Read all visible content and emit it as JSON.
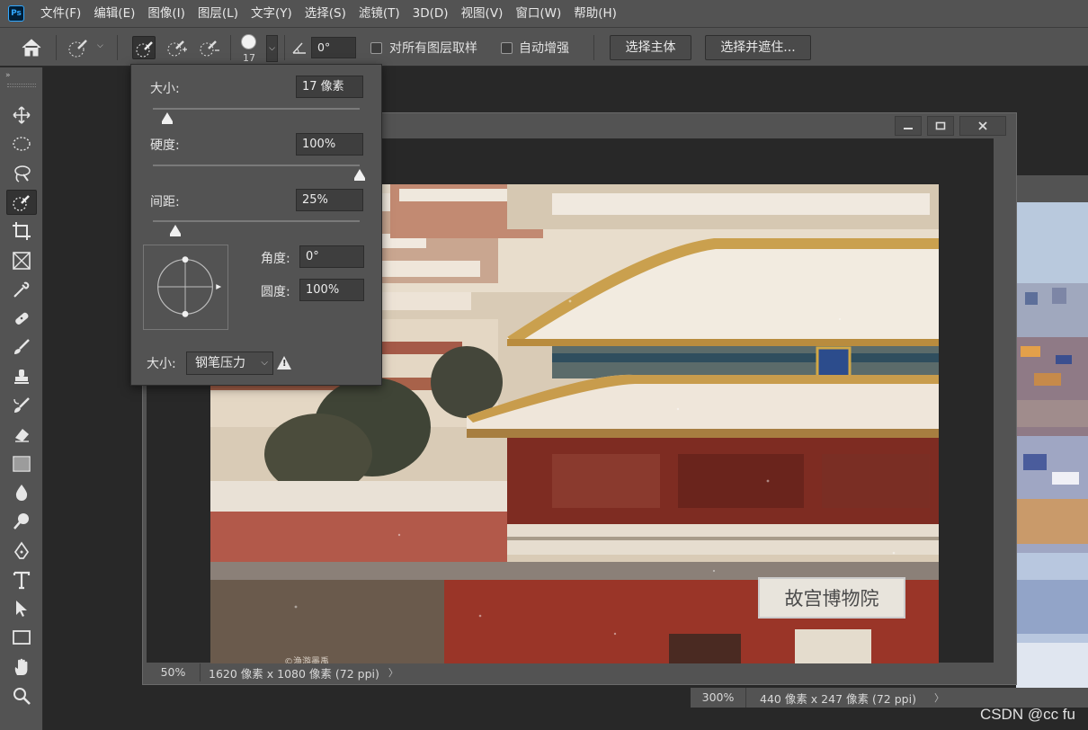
{
  "app": {
    "logo": "Ps",
    "menus": [
      "文件(F)",
      "编辑(E)",
      "图像(I)",
      "图层(L)",
      "文字(Y)",
      "选择(S)",
      "滤镜(T)",
      "3D(D)",
      "视图(V)",
      "窗口(W)",
      "帮助(H)"
    ]
  },
  "options": {
    "brush_size": "17",
    "angle": "0°",
    "sample_all_layers_label": "对所有图层取样",
    "sample_all_layers_checked": false,
    "auto_enhance_label": "自动增强",
    "auto_enhance_checked": false,
    "select_subject_label": "选择主体",
    "select_and_mask_label": "选择并遮住..."
  },
  "tools": [
    "move-icon",
    "elliptical-marquee-icon",
    "lasso-icon",
    "quick-selection-icon",
    "crop-icon",
    "frame-icon",
    "eyedropper-icon",
    "healing-brush-icon",
    "brush-icon",
    "clone-stamp-icon",
    "history-brush-icon",
    "eraser-icon",
    "gradient-icon",
    "blur-icon",
    "dodge-icon",
    "pen-icon",
    "type-icon",
    "path-selection-icon",
    "rectangle-icon",
    "hand-icon",
    "zoom-icon"
  ],
  "active_tool": "quick-selection-icon",
  "brush_panel": {
    "size_label": "大小:",
    "size_value": "17 像素",
    "size_level": 0.07,
    "hardness_label": "硬度:",
    "hardness_value": "100%",
    "hardness_level": 1.0,
    "spacing_label": "间距:",
    "spacing_value": "25%",
    "spacing_level": 0.11,
    "angle_label": "角度:",
    "angle_value": "0°",
    "roundness_label": "圆度:",
    "roundness_value": "100%",
    "pressure_label": "大小:",
    "pressure_value": "钢笔压力"
  },
  "document": {
    "zoom": "50%",
    "info": "1620 像素 x 1080 像素 (72 ppi)",
    "photo_sign_text": "故宫博物院",
    "photo_credit": "©渔游墨禹"
  },
  "document2": {
    "zoom": "300%",
    "info": "440 像素 x 247 像素 (72 ppi)"
  },
  "watermark": "CSDN @cc fu",
  "colors": {
    "ui_panel": "#535353",
    "ui_dark": "#282828",
    "accent": "#31a8ff"
  }
}
